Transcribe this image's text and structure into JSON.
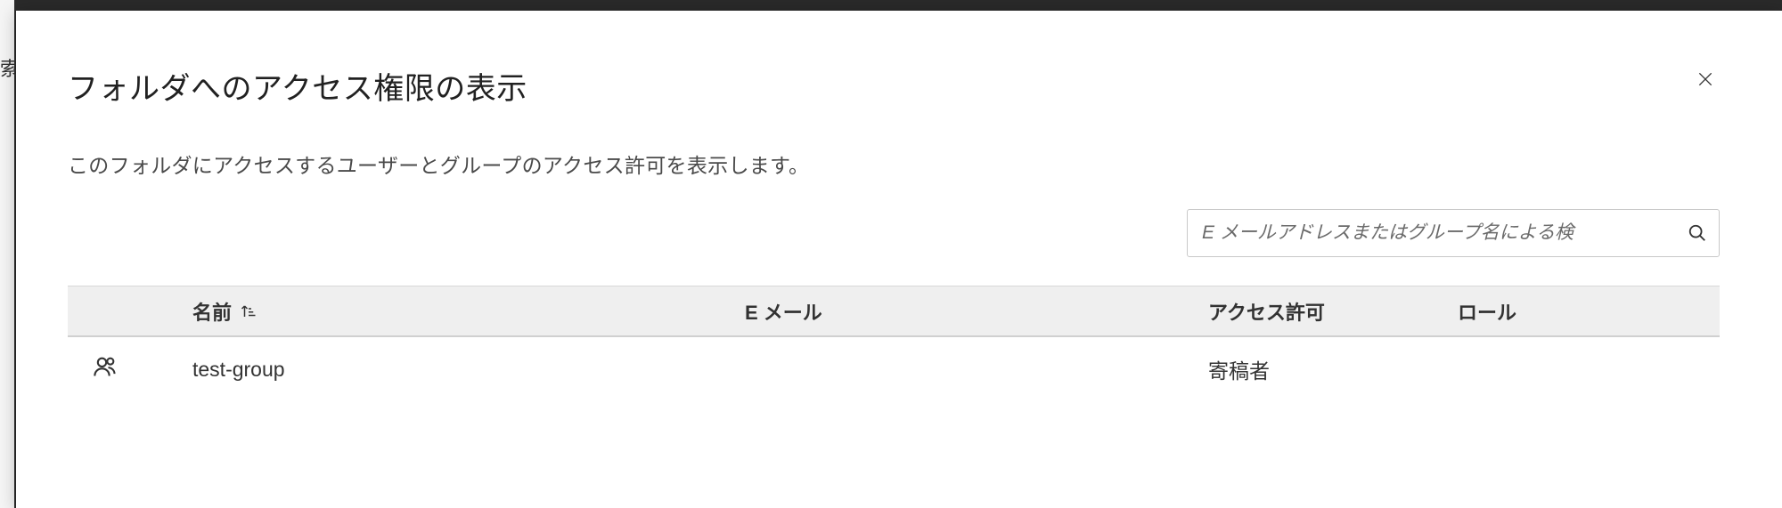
{
  "backdrop_hint": "索",
  "dialog": {
    "title": "フォルダへのアクセス権限の表示",
    "description": "このフォルダにアクセスするユーザーとグループのアクセス許可を表示します。"
  },
  "search": {
    "placeholder": "E メールアドレスまたはグループ名による検"
  },
  "table": {
    "headers": {
      "name": "名前",
      "email": "E メール",
      "permission": "アクセス許可",
      "role": "ロール"
    },
    "rows": [
      {
        "icon": "group",
        "name": "test-group",
        "email": "",
        "permission": "寄稿者",
        "role": ""
      }
    ]
  }
}
